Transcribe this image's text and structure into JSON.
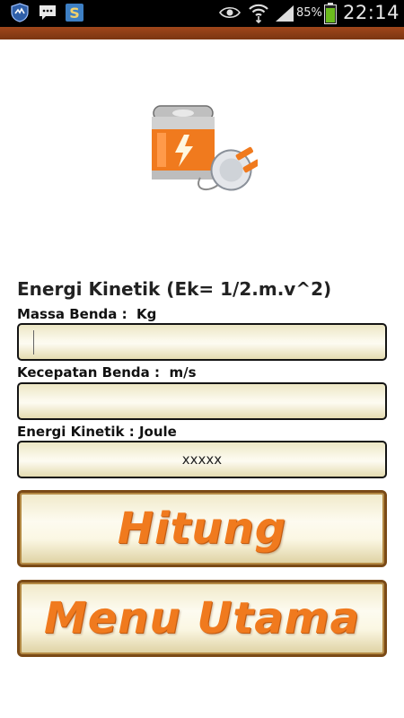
{
  "status_bar": {
    "battery_percent": "85%",
    "time": "22:14",
    "left_icons": [
      "app-shield-icon",
      "chat-bubble-icon",
      "s-app-icon"
    ],
    "right_icons": [
      "eye-icon",
      "wifi-icon",
      "signal-icon",
      "battery-icon"
    ]
  },
  "logo": {
    "icon": "battery-plug-icon"
  },
  "form": {
    "title": "Energi Kinetik (Ek= 1/2.m.v^2)",
    "mass_label": "Massa Benda :  Kg",
    "mass_value": "",
    "velocity_label": "Kecepatan Benda :  m/s",
    "velocity_value": "",
    "result_label": "Energi Kinetik : Joule",
    "result_value": "xxxxx"
  },
  "buttons": {
    "calculate_label": "Hitung",
    "main_menu_label": "Menu Utama"
  },
  "colors": {
    "accent_orange": "#f07a1e",
    "header_brown": "#8a3c14",
    "field_cream": "#f7f2d8"
  }
}
